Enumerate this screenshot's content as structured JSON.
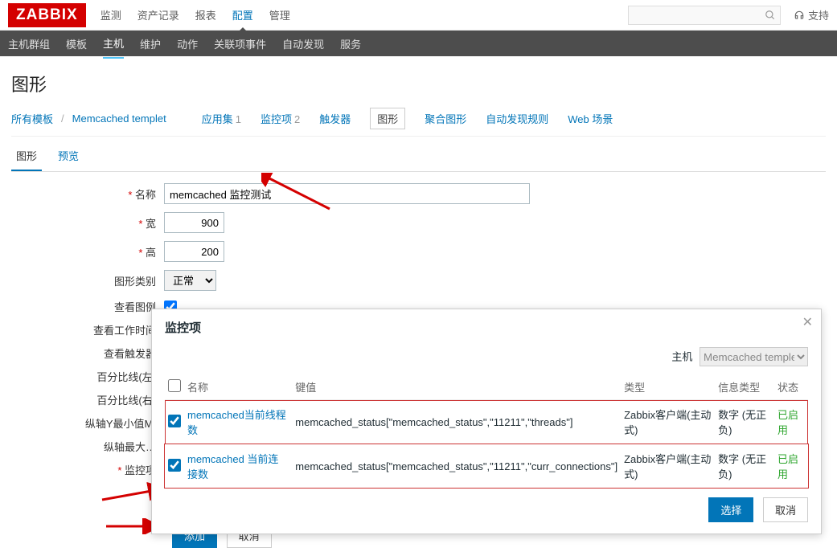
{
  "header": {
    "logo": "ZABBIX",
    "support": "支持",
    "nav": [
      "监测",
      "资产记录",
      "报表",
      "配置",
      "管理"
    ]
  },
  "subnav": [
    "主机群组",
    "模板",
    "主机",
    "维护",
    "动作",
    "关联项事件",
    "自动发现",
    "服务"
  ],
  "page": {
    "title": "图形"
  },
  "hostbar": {
    "bc1": "所有模板",
    "bc2": "Memcached templet",
    "tabs": [
      {
        "label": "应用集",
        "count": "1"
      },
      {
        "label": "监控项",
        "count": "2"
      },
      {
        "label": "触发器",
        "count": ""
      },
      {
        "label": "图形",
        "count": ""
      },
      {
        "label": "聚合图形",
        "count": ""
      },
      {
        "label": "自动发现规则",
        "count": ""
      },
      {
        "label": "Web 场景",
        "count": ""
      }
    ]
  },
  "innertabs": [
    "图形",
    "预览"
  ],
  "form": {
    "labels": {
      "name": "名称",
      "width": "宽",
      "height": "高",
      "gtype": "图形类别",
      "legend": "查看图例",
      "worktime": "查看工作时间",
      "triggers": "查看触发器",
      "pctleft": "百分比线(左)",
      "pctright": "百分比线(右)",
      "yminmi": "纵轴Y最小值MI",
      "ymax": "纵轴最大…",
      "items": "监控项"
    },
    "values": {
      "name": "memcached 监控测试",
      "width": "900",
      "height": "200",
      "gtype": "正常"
    },
    "add_link": "添加",
    "btn_add": "添加",
    "btn_cancel": "取消"
  },
  "modal": {
    "title": "监控项",
    "host_label": "主机",
    "host_value": "Memcached templet",
    "cols": {
      "name": "名称",
      "key": "键值",
      "type": "类型",
      "info": "信息类型",
      "status": "状态"
    },
    "rows": [
      {
        "name": "memcached当前线程数",
        "key": "memcached_status[\"memcached_status\",\"11211\",\"threads\"]",
        "type": "Zabbix客户端(主动式)",
        "info": "数字 (无正负)",
        "status": "已启用",
        "checked": true
      },
      {
        "name": "memcached 当前连接数",
        "key": "memcached_status[\"memcached_status\",\"11211\",\"curr_connections\"]",
        "type": "Zabbix客户端(主动式)",
        "info": "数字 (无正负)",
        "status": "已启用",
        "checked": true
      }
    ],
    "btn_select": "选择",
    "btn_cancel": "取消"
  }
}
